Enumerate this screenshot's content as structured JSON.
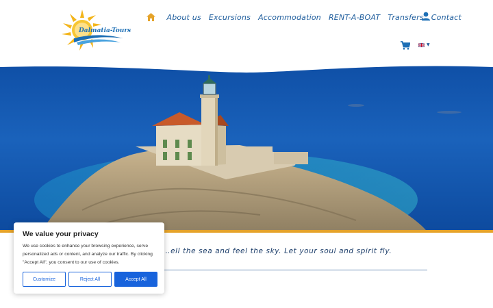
{
  "header": {
    "logo_text": "Dalmatia-Tours",
    "nav": [
      {
        "label": "About us"
      },
      {
        "label": "Excursions"
      },
      {
        "label": "Accommodation"
      },
      {
        "label": "RENT-A-BOAT"
      },
      {
        "label": "Transfers"
      },
      {
        "label": "Contact"
      }
    ],
    "icons": {
      "home": "home-icon",
      "user": "user-icon",
      "cart": "cart-icon",
      "language": "uk-flag-icon"
    },
    "accent_color": "#e5a32a",
    "nav_color": "#1d5c9c"
  },
  "hero": {
    "tagline": "…ell the sea and feel the sky. Let your soul and spirit fly."
  },
  "cookie_banner": {
    "title": "We value your privacy",
    "body": "We use cookies to enhance your browsing experience, serve personalized ads or content, and analyze our traffic. By clicking \"Accept All\", you consent to our use of cookies.",
    "customize_label": "Customize",
    "reject_label": "Reject All",
    "accept_label": "Accept All",
    "button_color": "#1863dc"
  }
}
